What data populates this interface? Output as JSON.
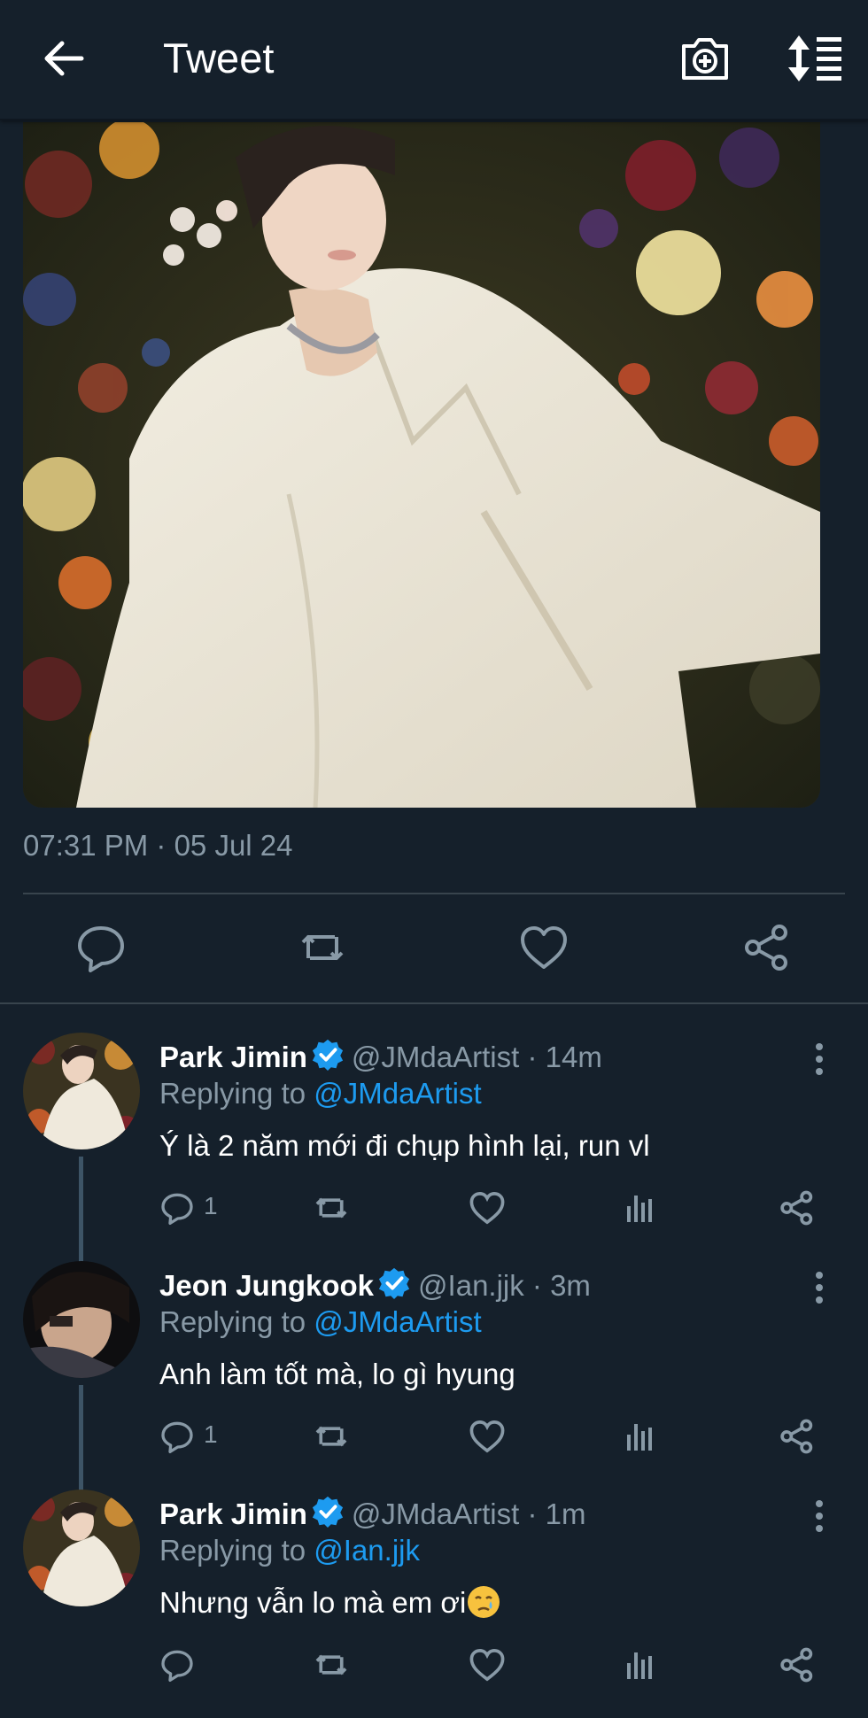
{
  "header": {
    "title": "Tweet"
  },
  "tweet": {
    "timestamp": "07:31 PM · 05 Jul 24"
  },
  "replies": [
    {
      "name": "Park Jimin",
      "handle": "@JMdaArtist · 14m",
      "replying_label": "Replying to",
      "replying_to": "@JMdaArtist",
      "text": "Ý là 2 năm mới đi chụp hình lại, run vl",
      "reply_count": "1"
    },
    {
      "name": "Jeon Jungkook",
      "handle": "@Ian.jjk · 3m",
      "replying_label": "Replying to",
      "replying_to": "@JMdaArtist",
      "text": "Anh làm tốt mà, lo gì hyung",
      "reply_count": "1"
    },
    {
      "name": "Park Jimin",
      "handle": "@JMdaArtist · 1m",
      "replying_label": "Replying to",
      "replying_to": "@Ian.jjk",
      "text": "Nhưng vẫn lo mà em ơi",
      "reply_count": ""
    }
  ],
  "colors": {
    "background": "#15202b",
    "accent": "#1d9bf0",
    "muted": "#8899a6",
    "divider": "#38444d"
  },
  "icons": [
    "back-arrow-icon",
    "camera-add-icon",
    "sort-icon",
    "reply-icon",
    "retweet-icon",
    "like-icon",
    "share-icon",
    "analytics-icon",
    "more-icon",
    "verified-icon",
    "crying-emoji-icon"
  ]
}
